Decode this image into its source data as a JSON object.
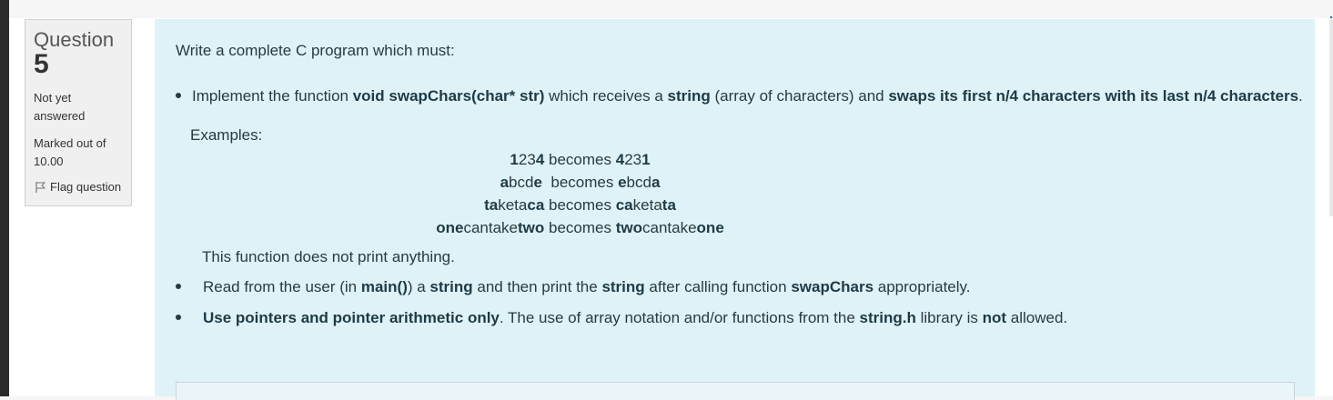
{
  "info": {
    "question_word": "Question",
    "question_number": "5",
    "state": "Not yet answered",
    "grade": "Marked out of 10.00",
    "flag_label": "Flag question"
  },
  "content": {
    "intro": "Write a complete C program which must:",
    "bullet1": {
      "t1": "Implement the function ",
      "b1": "void swapChars(char* str)",
      "t2": " which receives a ",
      "b2": "string",
      "t3": " (array of characters) and ",
      "b3": "swaps its first n/4 characters with its last n/4 characters",
      "t4": "."
    },
    "examples_label": "Examples:",
    "examples": [
      {
        "a_b1": "1",
        "a_m": "23",
        "a_b2": "4",
        "word": " becomes ",
        "r_b1": "4",
        "r_m": "23",
        "r_b2": "1"
      },
      {
        "a_b1": "a",
        "a_m": "bcd",
        "a_b2": "e",
        "word": "  becomes ",
        "r_b1": "e",
        "r_m": "bcd",
        "r_b2": "a"
      },
      {
        "a_b1": "ta",
        "a_m": "keta",
        "a_b2": "ca",
        "word": " becomes ",
        "r_b1": "ca",
        "r_m": "keta",
        "r_b2": "ta"
      },
      {
        "a_b1": "one",
        "a_m": "cantake",
        "a_b2": "two",
        "word": " becomes ",
        "r_b1": "two",
        "r_m": "cantake",
        "r_b2": "one"
      }
    ],
    "note": "This function does not print anything.",
    "bullet2": {
      "t1": "Read from the user (in ",
      "b1": "main()",
      "t2": ") a ",
      "b2": "string",
      "t3": " and then print the ",
      "b3": "string",
      "t4": " after calling function ",
      "b4": "swapChars",
      "t5": " appropriately."
    },
    "bullet3": {
      "b1": "Use pointers and pointer arithmetic only",
      "t1": ". The use of array notation and/or functions from the ",
      "b2": "string.h",
      "t2": " library is ",
      "b3": "not",
      "t3": " allowed."
    }
  }
}
